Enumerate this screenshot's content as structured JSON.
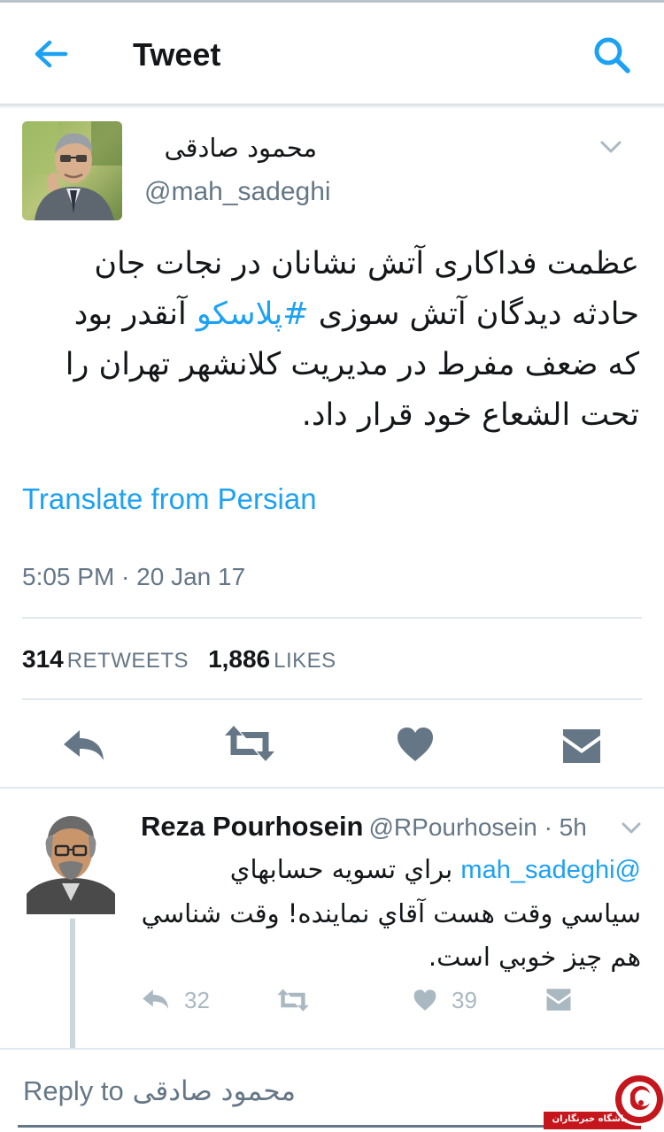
{
  "header": {
    "title": "Tweet"
  },
  "tweet": {
    "author_name": "محمود صادقی",
    "author_handle": "@mah_sadeghi",
    "text_line1": "عظمت فداکاری آتش نشانان در نجات جان",
    "text_line2_before": "حادثه دیدگان آتش سوزی ",
    "hashtag": "#پلاسکو",
    "text_line2_after": " آنقدر بود",
    "text_line3": "که ضعف مفرط در مدیریت کلانشهر تهران را",
    "text_line4": "تحت الشعاع خود قرار داد.",
    "translate_label": "Translate from Persian",
    "timestamp": "5:05 PM · 20 Jan 17",
    "retweets_count": "314",
    "retweets_label": "RETWEETS",
    "likes_count": "1,886",
    "likes_label": "LIKES"
  },
  "reply": {
    "name": "Reza Pourhosein",
    "meta": "@RPourhosein · 5h",
    "mention": "@mah_sadeghi",
    "text_line1": " براي تسويه حسابهاي",
    "text_line2": "سياسي وقت هست آقاي نماينده! وقت شناسي",
    "text_line3": "هم چيز خوبي است.",
    "reply_count": "32",
    "like_count": "39"
  },
  "reply_bar": {
    "prefix": "Reply to",
    "name": "محمود صادقی"
  },
  "watermark": {
    "text": "باشگاه خبرنگاران"
  },
  "colors": {
    "accent": "#1da1f2",
    "text": "#14171a",
    "secondary": "#657786",
    "icon_dark": "#657786",
    "icon_light": "#aab8c2",
    "divider": "#e1e8ed"
  }
}
